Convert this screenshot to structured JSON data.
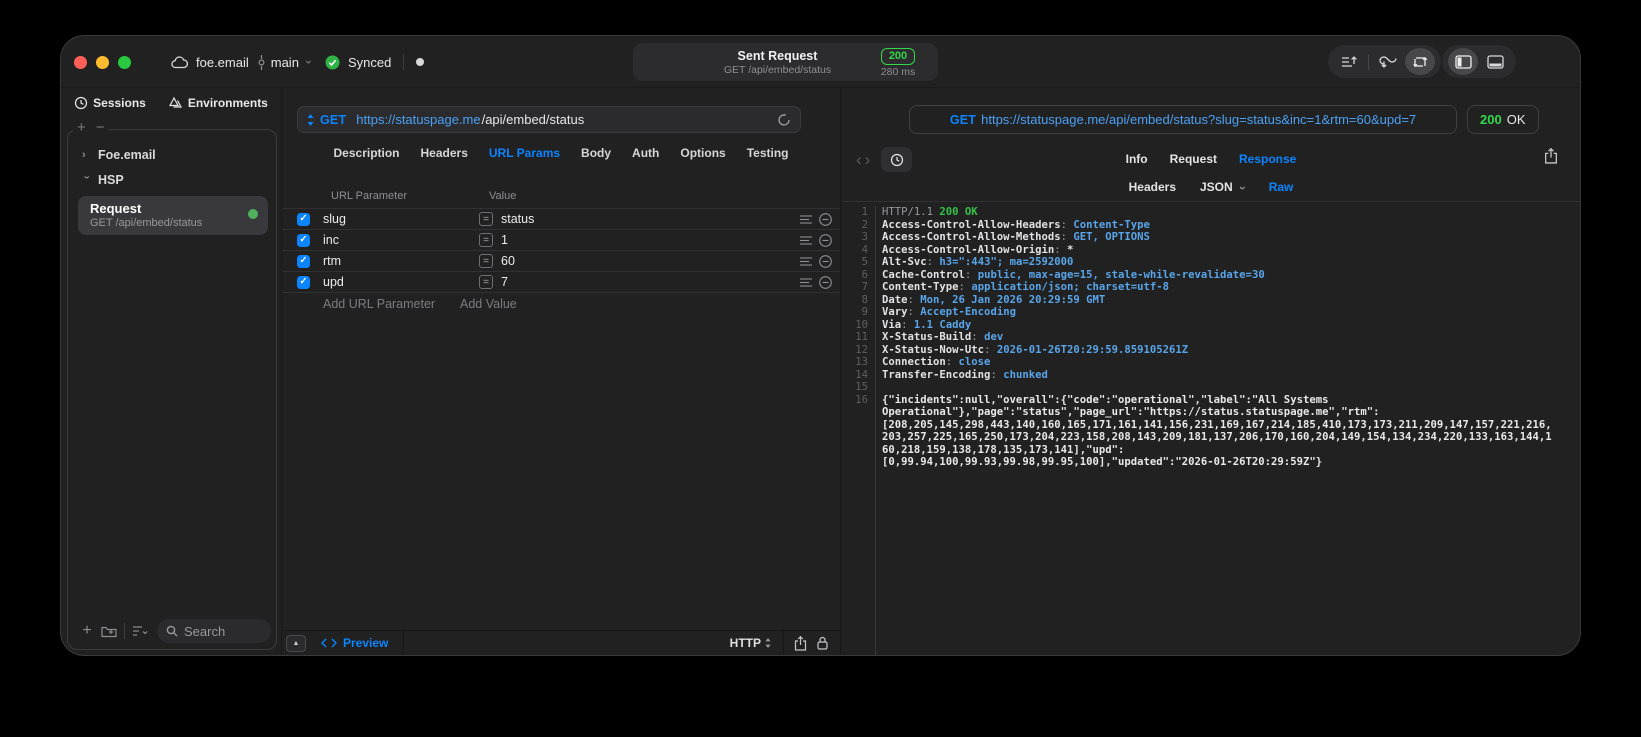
{
  "colors": {
    "accent_blue": "#0a84ff",
    "url_blue": "#4ba0f4",
    "code_value_blue": "#58a5ea",
    "status_green": "#32d74b",
    "checkbox_blue": "#0a84ff",
    "selected_item_gray": "#39393d",
    "window_background": "#212121"
  },
  "titlebar": {
    "project": "foe.email",
    "branch": "main",
    "sync_status": "Synced",
    "request_title": "Sent Request",
    "request_subtitle": "GET /api/embed/status",
    "status_code": "200",
    "duration": "280 ms"
  },
  "sidebar": {
    "tabs": [
      {
        "label": "Sessions",
        "icon": "history-icon"
      },
      {
        "label": "Environments",
        "icon": "environments-icon"
      }
    ],
    "tree": [
      {
        "label": "Foe.email",
        "expanded": false
      },
      {
        "label": "HSP",
        "expanded": true
      }
    ],
    "request_item": {
      "title": "Request",
      "subtitle": "GET /api/embed/status",
      "status_dot": "green"
    },
    "search_placeholder": "Search"
  },
  "request_pane": {
    "method": "GET",
    "url_host": "https://statuspage.me",
    "url_path": "/api/embed/status",
    "tabs": [
      "Description",
      "Headers",
      "URL Params",
      "Body",
      "Auth",
      "Options",
      "Testing"
    ],
    "active_tab": "URL Params",
    "table": {
      "columns": [
        "URL Parameter",
        "Value"
      ],
      "rows": [
        {
          "enabled": true,
          "name": "slug",
          "value": "status"
        },
        {
          "enabled": true,
          "name": "inc",
          "value": "1"
        },
        {
          "enabled": true,
          "name": "rtm",
          "value": "60"
        },
        {
          "enabled": true,
          "name": "upd",
          "value": "7"
        }
      ],
      "add_name_placeholder": "Add URL Parameter",
      "add_value_placeholder": "Add Value"
    },
    "bottom_bar": {
      "preview_label": "Preview",
      "protocol_label": "HTTP"
    }
  },
  "response_pane": {
    "method": "GET",
    "url": "https://statuspage.me/api/embed/status?slug=status&inc=1&rtm=60&upd=7",
    "status_code": "200",
    "status_text": "OK",
    "tabs": [
      "Info",
      "Request",
      "Response"
    ],
    "active_tab": "Response",
    "subtabs": [
      "Headers",
      "JSON",
      "Raw"
    ],
    "active_subtab": "Raw",
    "body_lines": [
      {
        "n": "1",
        "parts": [
          [
            "HTTP/1.1 ",
            "g"
          ],
          [
            "200 OK",
            "gr"
          ]
        ]
      },
      {
        "n": "2",
        "parts": [
          [
            "Access-Control-Allow-Headers",
            "k"
          ],
          [
            ": ",
            "g"
          ],
          [
            "Content-Type",
            "v"
          ]
        ]
      },
      {
        "n": "3",
        "parts": [
          [
            "Access-Control-Allow-Methods",
            "k"
          ],
          [
            ": ",
            "g"
          ],
          [
            "GET, OPTIONS",
            "v"
          ]
        ]
      },
      {
        "n": "4",
        "parts": [
          [
            "Access-Control-Allow-Origin",
            "k"
          ],
          [
            ": ",
            "g"
          ],
          [
            "*",
            "w"
          ]
        ]
      },
      {
        "n": "5",
        "parts": [
          [
            "Alt-Svc",
            "k"
          ],
          [
            ": ",
            "g"
          ],
          [
            "h3=\":443\"; ma=2592000",
            "v"
          ]
        ]
      },
      {
        "n": "6",
        "parts": [
          [
            "Cache-Control",
            "k"
          ],
          [
            ": ",
            "g"
          ],
          [
            "public, max-age=15, stale-while-revalidate=30",
            "v"
          ]
        ]
      },
      {
        "n": "7",
        "parts": [
          [
            "Content-Type",
            "k"
          ],
          [
            ": ",
            "g"
          ],
          [
            "application/json; charset=utf-8",
            "v"
          ]
        ]
      },
      {
        "n": "8",
        "parts": [
          [
            "Date",
            "k"
          ],
          [
            ": ",
            "g"
          ],
          [
            "Mon, 26 Jan 2026 20:29:59 GMT",
            "v"
          ]
        ]
      },
      {
        "n": "9",
        "parts": [
          [
            "Vary",
            "k"
          ],
          [
            ": ",
            "g"
          ],
          [
            "Accept-Encoding",
            "v"
          ]
        ]
      },
      {
        "n": "10",
        "parts": [
          [
            "Via",
            "k"
          ],
          [
            ": ",
            "g"
          ],
          [
            "1.1 Caddy",
            "v"
          ]
        ]
      },
      {
        "n": "11",
        "parts": [
          [
            "X-Status-Build",
            "k"
          ],
          [
            ": ",
            "g"
          ],
          [
            "dev",
            "v"
          ]
        ]
      },
      {
        "n": "12",
        "parts": [
          [
            "X-Status-Now-Utc",
            "k"
          ],
          [
            ": ",
            "g"
          ],
          [
            "2026-01-26T20:29:59.859105261Z",
            "v"
          ]
        ]
      },
      {
        "n": "13",
        "parts": [
          [
            "Connection",
            "k"
          ],
          [
            ": ",
            "g"
          ],
          [
            "close",
            "v"
          ]
        ]
      },
      {
        "n": "14",
        "parts": [
          [
            "Transfer-Encoding",
            "k"
          ],
          [
            ": ",
            "g"
          ],
          [
            "chunked",
            "v"
          ]
        ]
      },
      {
        "n": "15",
        "parts": []
      },
      {
        "n": "16",
        "parts": [
          [
            "{\"incidents\":null,\"overall\":{\"code\":\"operational\",\"label\":\"All Systems",
            "w"
          ]
        ]
      },
      {
        "n": "",
        "parts": [
          [
            "Operational\"},\"page\":\"status\",\"page_url\":\"https://status.statuspage.me\",\"rtm\":",
            "w"
          ]
        ]
      },
      {
        "n": "",
        "parts": [
          [
            "[208,205,145,298,443,140,160,165,171,161,141,156,231,169,167,214,185,410,173,173,211,209,147,157,221,216,",
            "w"
          ]
        ]
      },
      {
        "n": "",
        "parts": [
          [
            "203,257,225,165,250,173,204,223,158,208,143,209,181,137,206,170,160,204,149,154,134,234,220,133,163,144,1",
            "w"
          ]
        ]
      },
      {
        "n": "",
        "parts": [
          [
            "60,218,159,138,178,135,173,141],\"upd\":",
            "w"
          ]
        ]
      },
      {
        "n": "",
        "parts": [
          [
            "[0,99.94,100,99.93,99.98,99.95,100],\"updated\":\"2026-01-26T20:29:59Z\"}",
            "w"
          ]
        ]
      }
    ]
  }
}
